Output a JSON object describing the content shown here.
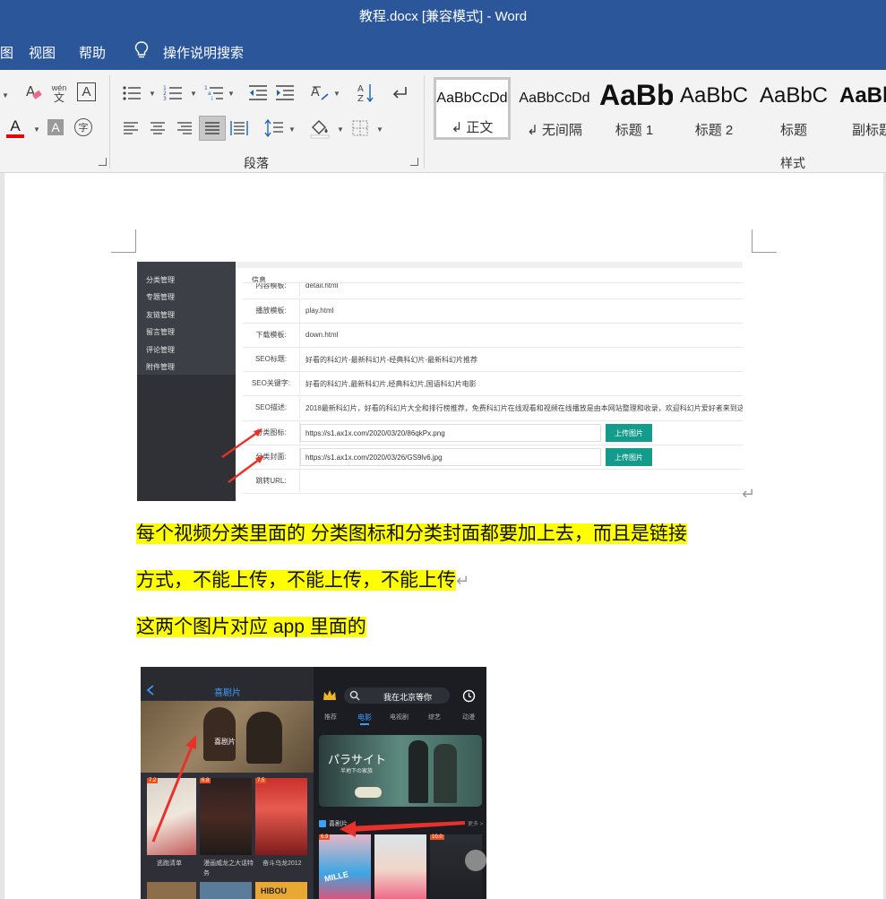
{
  "window": {
    "title": "教程.docx [兼容模式]  -  Word"
  },
  "menu": {
    "items": [
      "图",
      "视图",
      "帮助"
    ],
    "search_label": "操作说明搜索"
  },
  "ribbon": {
    "groups": {
      "paragraph": "段落",
      "styles": "样式"
    },
    "font_icons": {
      "pinyin_top": "wén",
      "pinyin_bottom": "文",
      "font_color": "A",
      "char_shading": "A",
      "enclose_char": "字"
    },
    "styles": [
      {
        "sample": "AaBbCcDd",
        "name": "↲ 正文",
        "selected": true
      },
      {
        "sample": "AaBbCcDd",
        "name": "↲ 无间隔",
        "selected": false
      },
      {
        "sample": "AaBb",
        "name": "标题 1",
        "selected": false
      },
      {
        "sample": "AaBbC",
        "name": "标题 2",
        "selected": false
      },
      {
        "sample": "AaBbC",
        "name": "标题",
        "selected": false
      },
      {
        "sample": "AaBl",
        "name": "副标题",
        "selected": false
      }
    ]
  },
  "admin_screenshot": {
    "sidebar": [
      "分类管理",
      "专题管理",
      "友链管理",
      "留言管理",
      "评论管理",
      "附件管理"
    ],
    "info": "信息",
    "rows": [
      {
        "label": "内容模板:",
        "value": "detail.html"
      },
      {
        "label": "播放模板:",
        "value": "play.html"
      },
      {
        "label": "下载模板:",
        "value": "down.html"
      },
      {
        "label": "SEO标题:",
        "value": "好看的科幻片-最新科幻片-经典科幻片-最新科幻片推荐"
      },
      {
        "label": "SEO关键字:",
        "value": "好看的科幻片,最新科幻片,经典科幻片,国语科幻片电影"
      },
      {
        "label": "SEO描述:",
        "value": "2018最新科幻片，好看的科幻片大全和排行榜推荐，免费科幻片在线观看和视频在线播放是由本网站整理和收录，欢迎科幻片爱好者来到这里"
      },
      {
        "label": "分类图标:",
        "value": "https://s1.ax1x.com/2020/03/20/86qkPx.png",
        "button": "上传图片"
      },
      {
        "label": "分类封面:",
        "value": "https://s1.ax1x.com/2020/03/26/GS9lv6.jpg",
        "button": "上传图片"
      },
      {
        "label": "跳转URL:",
        "value": ""
      }
    ]
  },
  "document": {
    "para1_line1": "每个视频分类里面的  分类图标和分类封面都要加上去，而且是链接",
    "para1_line2": "方式，不能上传，不能上传，不能上传",
    "para2": "这两个图片对应 app 里面的",
    "pilcrow": "↵"
  },
  "app_screenshot": {
    "left_title": "喜剧片",
    "left_banner_label": "喜剧片",
    "left_items": [
      "逃跑清单",
      "漫画威龙之大话特务",
      "奋斗乌龙2012"
    ],
    "right_search": "我在北京等你",
    "right_tabs": [
      "推荐",
      "电影",
      "电视剧",
      "综艺",
      "动漫"
    ],
    "right_active_tab": "电影",
    "right_banner_text": "パラサイト",
    "right_banner_sub": "半地下の家族",
    "right_section": "喜剧片",
    "right_more": "更多 >",
    "ratings": [
      "7.2",
      "6.8",
      "7.5",
      "6.9",
      "10.0"
    ],
    "poster_text_hibou": "HIBOU",
    "poster_text_mille": "MILLE"
  }
}
